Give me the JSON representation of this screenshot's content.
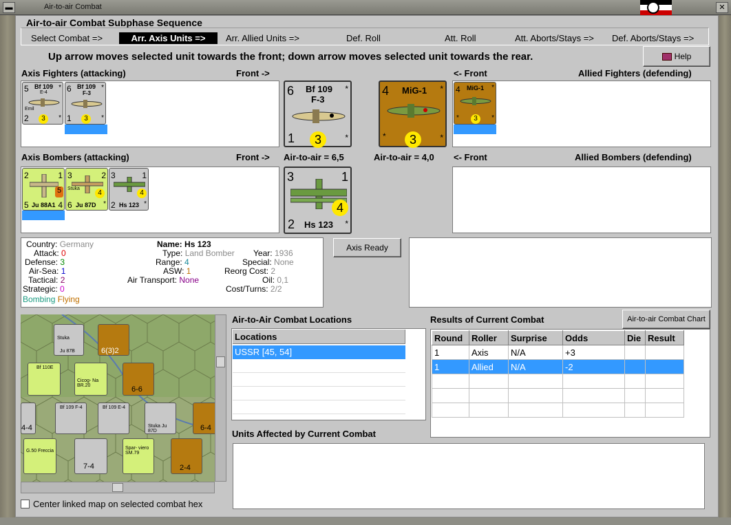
{
  "window": {
    "title": "Air-to-air Combat"
  },
  "sequence": {
    "title": "Air-to-air Combat Subphase Sequence",
    "steps": [
      "Select Combat =>",
      "Arr. Axis Units =>",
      "Arr. Allied Units =>",
      "Def. Roll",
      "Att. Roll",
      "Att. Aborts/Stays =>",
      "Def. Aborts/Stays =>"
    ],
    "active_index": 1
  },
  "instruction": "Up arrow moves selected unit towards the front; down arrow moves selected unit towards the rear.",
  "help_label": "Help",
  "headers": {
    "axis_fighters": "Axis Fighters (attacking)",
    "front_right": "Front ->",
    "front_left": "<- Front",
    "allied_fighters": "Allied Fighters (defending)",
    "axis_bombers": "Axis Bombers (attacking)",
    "allied_bombers": "Allied Bombers (defending)",
    "axis_a2a": "Air-to-air = 6,5",
    "allied_a2a": "Air-to-air = 4,0"
  },
  "counters": {
    "axis_fighters": [
      {
        "name": "Bf 109",
        "sub": "E-4",
        "tl": "5",
        "bl": "2",
        "yc": "3",
        "note": "Emil",
        "tr": "*",
        "br": "*"
      },
      {
        "name": "Bf 109",
        "sub": "F-3",
        "tl": "6",
        "bl": "1",
        "yc": "3",
        "tr": "*",
        "br": "*"
      }
    ],
    "axis_selected_fighter": {
      "name": "Bf 109",
      "sub": "F-3",
      "tl": "6",
      "bl": "1",
      "yc": "3",
      "tr": "*",
      "br": "*"
    },
    "allied_selected_fighter": {
      "name": "MiG-1",
      "tl": "4",
      "yc": "3",
      "tr": "*",
      "bl": "*",
      "br": "*"
    },
    "allied_fighters": [
      {
        "name": "MiG-1",
        "tl": "4",
        "yc": "3",
        "tr": "*",
        "bl": "*",
        "br": "*"
      }
    ],
    "axis_bombers": [
      {
        "name": "Ju 88A1",
        "tl": "2",
        "tr": "1",
        "bl": "5",
        "br": "4",
        "oc": "5"
      },
      {
        "name": "Ju 87D",
        "sub": "Stuka",
        "tl": "3",
        "tr": "2",
        "bl": "6",
        "br": "*",
        "yc": "4"
      },
      {
        "name": "Hs 123",
        "tl": "3",
        "tr": "1",
        "bl": "2",
        "br": "*",
        "yc": "4"
      }
    ],
    "axis_selected_bomber": {
      "name": "Hs 123",
      "tl": "3",
      "tr": "1",
      "bl": "2",
      "br": "*",
      "yc": "4"
    }
  },
  "unit_info": {
    "country_label": "Country:",
    "country": "Germany",
    "attack_label": "Attack:",
    "attack": "0",
    "defense_label": "Defense:",
    "defense": "3",
    "airsea_label": "Air-Sea:",
    "airsea": "1",
    "tactical_label": "Tactical:",
    "tactical": "2",
    "strategic_label": "Strategic:",
    "strategic": "0",
    "bombing": "Bombing",
    "flying": "Flying",
    "name_label": "Name:",
    "name": "Hs 123",
    "type_label": "Type:",
    "type": "Land Bomber",
    "range_label": "Range:",
    "range": "4",
    "asw_label": "ASW:",
    "asw": "1",
    "air_transport_label": "Air Transport:",
    "air_transport": "None",
    "year_label": "Year:",
    "year": "1936",
    "special_label": "Special:",
    "special": "None",
    "reorg_label": "Reorg Cost:",
    "reorg": "2",
    "oil_label": "Oil:",
    "oil": "0,1",
    "cost_label": "Cost/Turns:",
    "cost": "2/2"
  },
  "axis_ready_label": "Axis Ready",
  "locations": {
    "title": "Air-to-Air Combat Locations",
    "header": "Locations",
    "rows": [
      "USSR [45, 54]"
    ]
  },
  "results": {
    "title": "Results of Current Combat",
    "chart_button": "Air-to-air Combat Chart",
    "columns": [
      "Round",
      "Roller",
      "Surprise",
      "Odds",
      "Die",
      "Result"
    ],
    "rows": [
      [
        "1",
        "Axis",
        "N/A",
        "+3",
        "",
        ""
      ],
      [
        "1",
        "Allied",
        "N/A",
        "-2",
        "",
        ""
      ]
    ]
  },
  "units_affected_title": "Units Affected by Current Combat",
  "center_map_label": "Center linked map on selected combat hex",
  "map_labels": {
    "c1": "Stuka",
    "c1b": "Ju 87B",
    "c2": "6(3)2",
    "c3": "Bf 110E",
    "c4": "Cicog- Na BR.20",
    "c5": "6-6",
    "c6": "Bf 109 F-4",
    "c7": "Bf 109 E-4",
    "c8": "Stuka Ju 87D",
    "c9": "6-4",
    "c10": "G.50 Freccia",
    "c11": "7-4",
    "c12": "Spar- viero SM.79",
    "c13": "2-4",
    "c14": "4-4"
  },
  "colors": {
    "axis_counter": "#c8c8c8",
    "soviet_counter": "#b57a10",
    "italian_counter": "#d4f07a",
    "selected_blue": "#3399ff",
    "yellow_circle": "#ffe800"
  }
}
